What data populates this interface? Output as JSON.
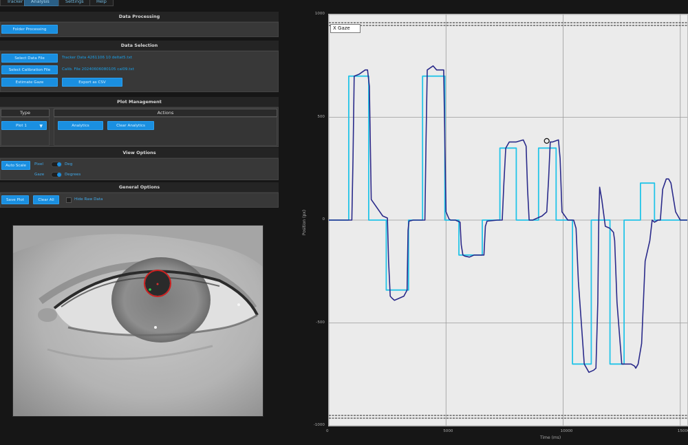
{
  "tabs": [
    {
      "label": "Tracker",
      "active": false
    },
    {
      "label": "Analysis",
      "active": true
    },
    {
      "label": "Settings",
      "active": false
    },
    {
      "label": "Help",
      "active": false
    }
  ],
  "data_processing": {
    "title": "Data Processing",
    "process_button": "Folder Processing"
  },
  "data_selection": {
    "title": "Data Selection",
    "select_data_button": "Select Data File",
    "data_file_path": "Tracker Data 4261106 10 deltat5.txt",
    "select_calibration_button": "Select Calibration File",
    "calibration_file_path": "Calib. File 20240606080105 cal09.txt",
    "estimate_gaze_button": "Estimate Gaze",
    "export_csv_button": "Export as CSV"
  },
  "plot_management": {
    "title": "Plot Management",
    "type_header": "Type",
    "actions_header": "Actions",
    "type_select_value": "Plot 1",
    "analytics_button": "Analytics",
    "clear_analytics_button": "Clear Analytics"
  },
  "view_options": {
    "title": "View Options",
    "auto_scale_button": "Auto Scale",
    "toggle1_left": "Pixel",
    "toggle1_right": "Deg",
    "toggle2_left": "Gaze",
    "toggle2_right": "Degrees"
  },
  "general_options": {
    "title": "General Options",
    "save_plot_button": "Save Plot",
    "clear_all_button": "Clear All",
    "checkbox_label": "Hide Raw Data"
  },
  "chart_data": {
    "type": "line",
    "title": "",
    "legend": [
      "X Gaze"
    ],
    "xlabel": "Time (ms)",
    "ylabel": "Position (px)",
    "xlim": [
      0,
      15300
    ],
    "ylim": [
      -1000,
      1000
    ],
    "xticks": [
      0,
      5000,
      10000,
      15000
    ],
    "xtick_labels": [
      "0",
      "5000",
      "10000",
      "15000"
    ],
    "yticks": [
      1000,
      500,
      0,
      -500,
      -1000
    ],
    "ytick_labels": [
      "1000",
      "500",
      "0",
      "-500",
      "-1000"
    ],
    "reference_lines_y": [
      960,
      -950
    ],
    "colors": {
      "target": "#22c4e8",
      "gaze": "#2a2a8a"
    },
    "series": [
      {
        "name": "target",
        "x": [
          0,
          850,
          850,
          1700,
          1700,
          2450,
          2450,
          3400,
          3400,
          4000,
          4000,
          4950,
          4950,
          5550,
          5550,
          6550,
          6550,
          7300,
          7300,
          8000,
          8000,
          8950,
          8950,
          9700,
          9700,
          10400,
          10400,
          11200,
          11200,
          12000,
          12000,
          12600,
          12600,
          13300,
          13300,
          13900,
          13900,
          14600,
          14600,
          15300
        ],
        "y": [
          0,
          0,
          700,
          700,
          0,
          0,
          -340,
          -340,
          0,
          0,
          700,
          700,
          0,
          0,
          -170,
          -170,
          0,
          0,
          350,
          350,
          0,
          0,
          350,
          350,
          0,
          0,
          -700,
          -700,
          0,
          0,
          -700,
          -700,
          0,
          0,
          180,
          180,
          0,
          0,
          0,
          0
        ]
      },
      {
        "name": "gaze",
        "x": [
          0,
          980,
          1030,
          1080,
          1300,
          1550,
          1650,
          1730,
          1810,
          2300,
          2500,
          2550,
          2620,
          2700,
          2800,
          3000,
          3200,
          3340,
          3380,
          3420,
          3600,
          4100,
          4150,
          4200,
          4450,
          4600,
          4900,
          5000,
          5130,
          5200,
          5400,
          5600,
          5650,
          5720,
          5800,
          6000,
          6200,
          6620,
          6680,
          6750,
          7200,
          7400,
          7470,
          7550,
          7700,
          8000,
          8300,
          8420,
          8480,
          8550,
          8700,
          8900,
          9100,
          9300,
          9380,
          9450,
          9550,
          9800,
          9870,
          9950,
          10200,
          10300,
          10450,
          10550,
          10650,
          10900,
          11100,
          11300,
          11400,
          11480,
          11520,
          11560,
          11650,
          11800,
          12000,
          12150,
          12200,
          12300,
          12500,
          12900,
          13050,
          13100,
          13200,
          13350,
          13500,
          13700,
          13800,
          13900,
          14050,
          14150,
          14250,
          14400,
          14500,
          14600,
          14800,
          15000,
          15300
        ],
        "y": [
          0,
          0,
          300,
          700,
          710,
          730,
          730,
          650,
          100,
          20,
          10,
          -200,
          -370,
          -380,
          -390,
          -380,
          -370,
          -340,
          -50,
          -5,
          0,
          0,
          400,
          730,
          750,
          730,
          730,
          40,
          5,
          0,
          0,
          -10,
          -120,
          -170,
          -175,
          -180,
          -170,
          -170,
          -30,
          -5,
          0,
          0,
          180,
          350,
          380,
          380,
          390,
          360,
          150,
          0,
          0,
          10,
          20,
          40,
          200,
          380,
          380,
          390,
          300,
          40,
          0,
          0,
          0,
          -40,
          -300,
          -700,
          -740,
          -730,
          -720,
          -400,
          0,
          160,
          100,
          -30,
          -40,
          -60,
          -100,
          -400,
          -700,
          -700,
          -710,
          -720,
          -700,
          -600,
          -200,
          -100,
          0,
          -10,
          0,
          0,
          150,
          200,
          200,
          180,
          40,
          0,
          0
        ]
      }
    ]
  }
}
